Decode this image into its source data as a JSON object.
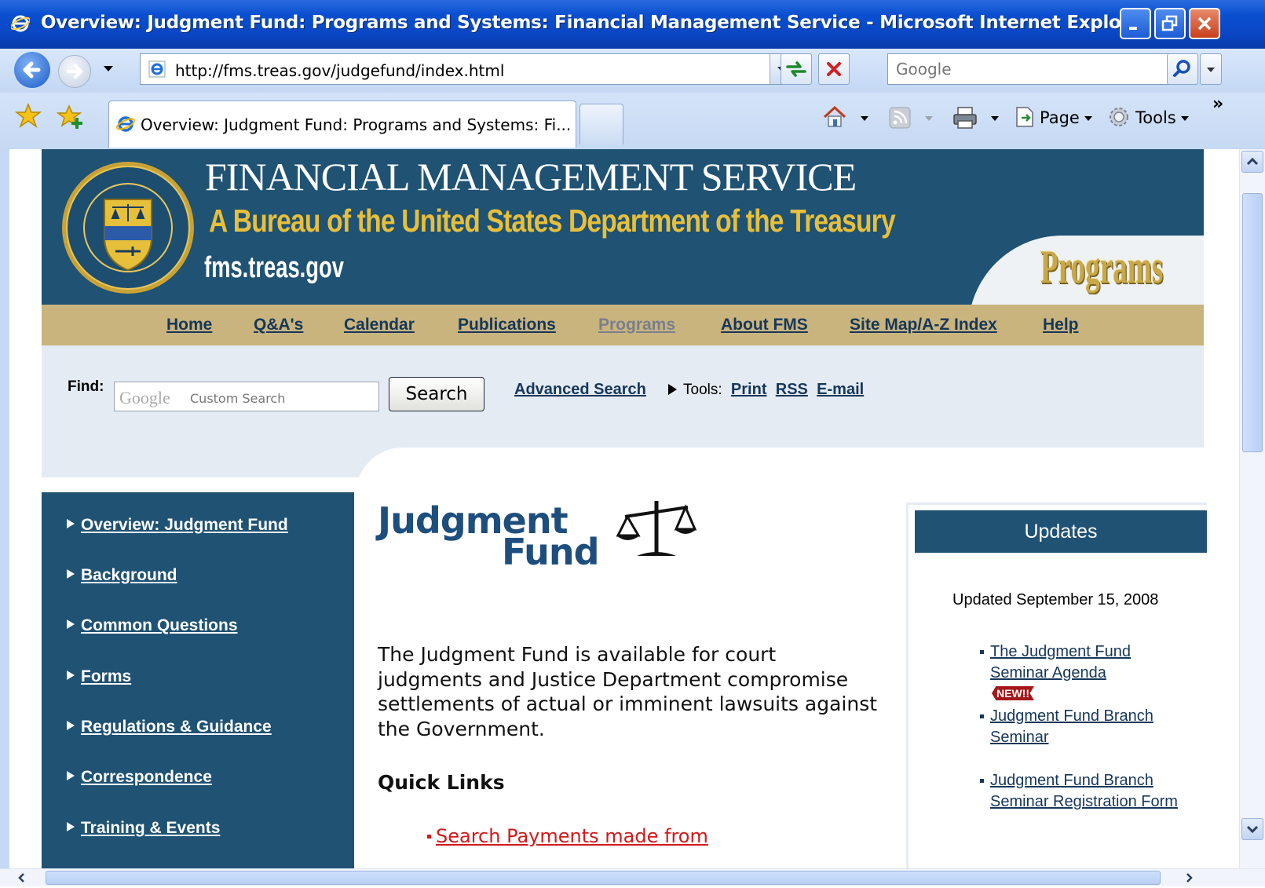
{
  "window": {
    "title": "Overview: Judgment Fund: Programs and Systems: Financial Management Service - Microsoft Internet Explorer ..."
  },
  "toolbar": {
    "address": "http://fms.treas.gov/judgefund/index.html",
    "search_placeholder": "Google",
    "tab_title": "Overview: Judgment Fund: Programs and Systems: Fi...",
    "page_label": "Page",
    "tools_label": "Tools",
    "chevron": "»"
  },
  "banner": {
    "title": "FINANCIAL MANAGEMENT SERVICE",
    "subtitle": "A Bureau of the United States Department of the Treasury",
    "url": "fms.treas.gov",
    "section": "Programs",
    "seal_text": "TREASURY · FINANCIAL MANAGEMENT SERVICE"
  },
  "nav": [
    {
      "label": "Home"
    },
    {
      "label": "Q&A's"
    },
    {
      "label": "Calendar"
    },
    {
      "label": "Publications"
    },
    {
      "label": "Programs"
    },
    {
      "label": "About FMS"
    },
    {
      "label": "Site Map/A-Z Index"
    },
    {
      "label": "Help"
    }
  ],
  "find": {
    "label": "Find:",
    "google_logo": "Google",
    "placeholder": "Custom Search",
    "button": "Search",
    "advanced": "Advanced Search",
    "tools_label": "Tools:",
    "print": "Print",
    "rss": "RSS",
    "email": "E-mail"
  },
  "sidebar": [
    {
      "label": "Overview: Judgment Fund"
    },
    {
      "label": "Background"
    },
    {
      "label": "Common Questions"
    },
    {
      "label": "Forms"
    },
    {
      "label": "Regulations & Guidance"
    },
    {
      "label": "Correspondence"
    },
    {
      "label": "Training & Events"
    }
  ],
  "main": {
    "logo_line1": "Judgment",
    "logo_line2": "Fund",
    "intro": "The Judgment Fund is available for court judgments and Justice Department compromise settlements of actual or imminent lawsuits against the Government.",
    "quick_links_heading": "Quick Links",
    "quick_links": [
      {
        "label": "Search Payments made from"
      }
    ]
  },
  "updates": {
    "heading": "Updates",
    "date": "Updated September 15, 2008",
    "items": [
      {
        "label": "The Judgment Fund Seminar Agenda",
        "badge": "NEW!!"
      },
      {
        "label": "Judgment Fund Branch Seminar"
      },
      {
        "label": "Judgment Fund Branch Seminar Registration Form"
      }
    ]
  },
  "colors": {
    "title_bar": "#0a46c4",
    "banner_blue": "#1f5273",
    "nav_gold": "#c9b47e",
    "link_navy": "#16375a",
    "quick_link_red": "#d21a1a",
    "badge_red": "#a4171a"
  }
}
